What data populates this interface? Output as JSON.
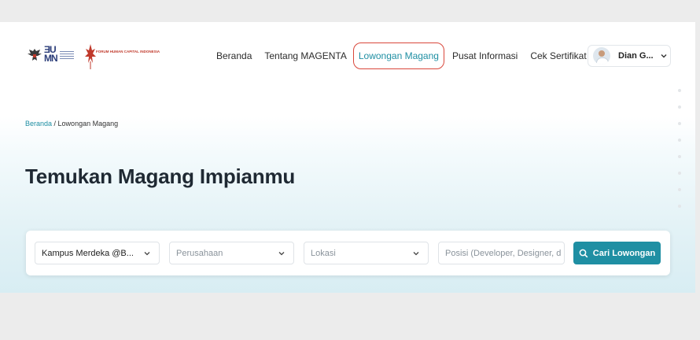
{
  "nav": {
    "items": [
      {
        "label": "Beranda"
      },
      {
        "label": "Tentang MAGENTA"
      },
      {
        "label": "Lowongan Magang",
        "active": true
      },
      {
        "label": "Pusat Informasi"
      },
      {
        "label": "Cek Sertifikat"
      }
    ]
  },
  "logos": {
    "bumn": "BUMN",
    "fhci": "FORUM HUMAN CAPITAL INDONESIA"
  },
  "user": {
    "name": "Dian G..."
  },
  "breadcrumb": {
    "home": "Beranda",
    "separator": " / ",
    "current": "Lowongan Magang"
  },
  "hero": {
    "title": "Temukan Magang Impianmu"
  },
  "search": {
    "program_value": "Kampus Merdeka @B...",
    "company_placeholder": "Perusahaan",
    "location_placeholder": "Lokasi",
    "position_placeholder": "Posisi (Developer, Designer, d",
    "button_label": "Cari Lowongan"
  },
  "colors": {
    "accent": "#1f8fa3",
    "highlight_outline": "#d9473b",
    "title_text": "#1f2933"
  }
}
